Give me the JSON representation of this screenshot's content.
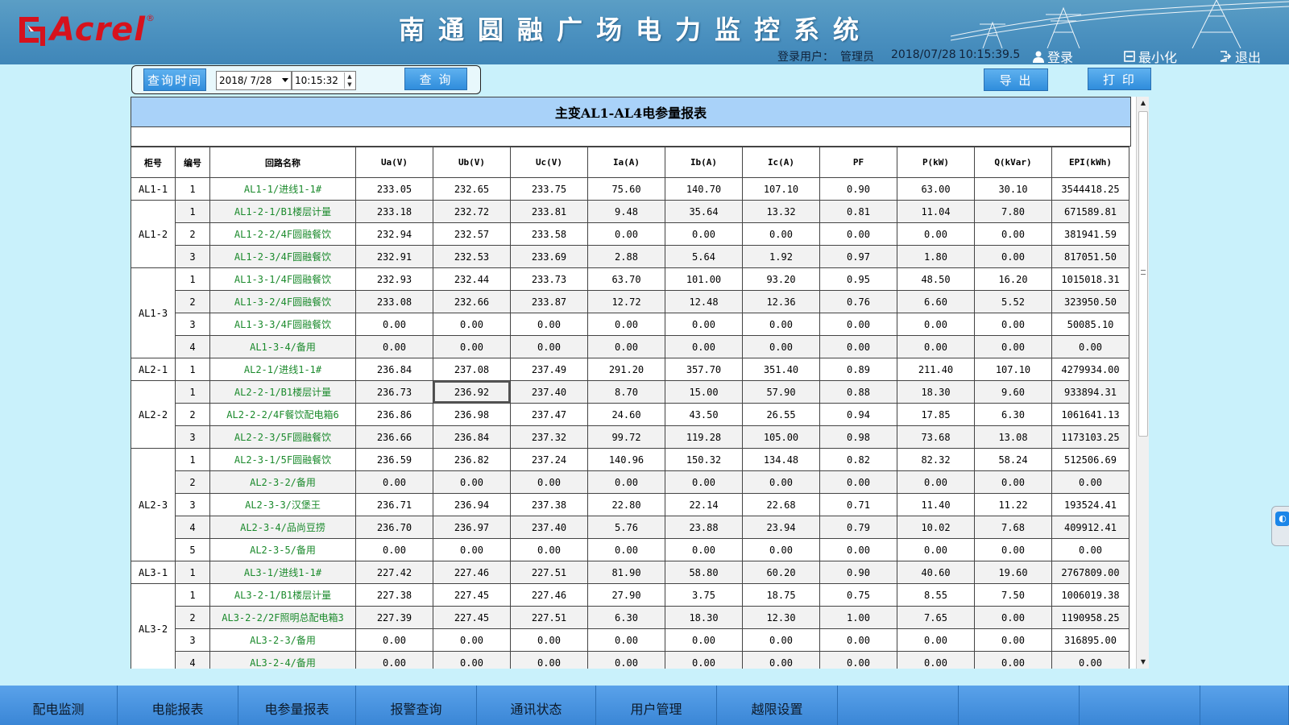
{
  "header": {
    "logo_text": "Acrel",
    "logo_reg": "®",
    "title": "南通圆融广场电力监控系统",
    "user_label": "登录用户：",
    "user_name": "管理员",
    "date": "2018/07/28",
    "time": "10:15:39.5",
    "login_label": "登录",
    "minimize_label": "最小化",
    "exit_label": "退出"
  },
  "query": {
    "time_button": "查询时间",
    "date_value": "2018/ 7/28",
    "time_value": "10:15:32",
    "search_button": "查 询"
  },
  "actions": {
    "export_label": "导 出",
    "print_label": "打 印"
  },
  "report": {
    "title": "主变AL1-AL4电参量报表",
    "columns": [
      "柜号",
      "编号",
      "回路名称",
      "Ua(V)",
      "Ub(V)",
      "Uc(V)",
      "Ia(A)",
      "Ib(A)",
      "Ic(A)",
      "PF",
      "P(kW)",
      "Q(kVar)",
      "EPI(kWh)"
    ],
    "groups": [
      {
        "cabinet": "AL1-1",
        "rows": [
          {
            "no": "1",
            "name": "AL1-1/进线1-1#",
            "ua": "233.05",
            "ub": "232.65",
            "uc": "233.75",
            "ia": "75.60",
            "ib": "140.70",
            "ic": "107.10",
            "pf": "0.90",
            "p": "63.00",
            "q": "30.10",
            "epi": "3544418.25"
          }
        ]
      },
      {
        "cabinet": "AL1-2",
        "rows": [
          {
            "no": "1",
            "name": "AL1-2-1/B1楼层计量",
            "ua": "233.18",
            "ub": "232.72",
            "uc": "233.81",
            "ia": "9.48",
            "ib": "35.64",
            "ic": "13.32",
            "pf": "0.81",
            "p": "11.04",
            "q": "7.80",
            "epi": "671589.81"
          },
          {
            "no": "2",
            "name": "AL1-2-2/4F圆融餐饮",
            "ua": "232.94",
            "ub": "232.57",
            "uc": "233.58",
            "ia": "0.00",
            "ib": "0.00",
            "ic": "0.00",
            "pf": "0.00",
            "p": "0.00",
            "q": "0.00",
            "epi": "381941.59"
          },
          {
            "no": "3",
            "name": "AL1-2-3/4F圆融餐饮",
            "ua": "232.91",
            "ub": "232.53",
            "uc": "233.69",
            "ia": "2.88",
            "ib": "5.64",
            "ic": "1.92",
            "pf": "0.97",
            "p": "1.80",
            "q": "0.00",
            "epi": "817051.50"
          }
        ]
      },
      {
        "cabinet": "AL1-3",
        "rows": [
          {
            "no": "1",
            "name": "AL1-3-1/4F圆融餐饮",
            "ua": "232.93",
            "ub": "232.44",
            "uc": "233.73",
            "ia": "63.70",
            "ib": "101.00",
            "ic": "93.20",
            "pf": "0.95",
            "p": "48.50",
            "q": "16.20",
            "epi": "1015018.31"
          },
          {
            "no": "2",
            "name": "AL1-3-2/4F圆融餐饮",
            "ua": "233.08",
            "ub": "232.66",
            "uc": "233.87",
            "ia": "12.72",
            "ib": "12.48",
            "ic": "12.36",
            "pf": "0.76",
            "p": "6.60",
            "q": "5.52",
            "epi": "323950.50"
          },
          {
            "no": "3",
            "name": "AL1-3-3/4F圆融餐饮",
            "ua": "0.00",
            "ub": "0.00",
            "uc": "0.00",
            "ia": "0.00",
            "ib": "0.00",
            "ic": "0.00",
            "pf": "0.00",
            "p": "0.00",
            "q": "0.00",
            "epi": "50085.10"
          },
          {
            "no": "4",
            "name": "AL1-3-4/备用",
            "ua": "0.00",
            "ub": "0.00",
            "uc": "0.00",
            "ia": "0.00",
            "ib": "0.00",
            "ic": "0.00",
            "pf": "0.00",
            "p": "0.00",
            "q": "0.00",
            "epi": "0.00"
          }
        ]
      },
      {
        "cabinet": "AL2-1",
        "rows": [
          {
            "no": "1",
            "name": "AL2-1/进线1-1#",
            "ua": "236.84",
            "ub": "237.08",
            "uc": "237.49",
            "ia": "291.20",
            "ib": "357.70",
            "ic": "351.40",
            "pf": "0.89",
            "p": "211.40",
            "q": "107.10",
            "epi": "4279934.00"
          }
        ]
      },
      {
        "cabinet": "AL2-2",
        "rows": [
          {
            "no": "1",
            "name": "AL2-2-1/B1楼层计量",
            "ua": "236.73",
            "ub": "236.92",
            "uc": "237.40",
            "ia": "8.70",
            "ib": "15.00",
            "ic": "57.90",
            "pf": "0.88",
            "p": "18.30",
            "q": "9.60",
            "epi": "933894.31"
          },
          {
            "no": "2",
            "name": "AL2-2-2/4F餐饮配电箱6",
            "ua": "236.86",
            "ub": "236.98",
            "uc": "237.47",
            "ia": "24.60",
            "ib": "43.50",
            "ic": "26.55",
            "pf": "0.94",
            "p": "17.85",
            "q": "6.30",
            "epi": "1061641.13"
          },
          {
            "no": "3",
            "name": "AL2-2-3/5F圆融餐饮",
            "ua": "236.66",
            "ub": "236.84",
            "uc": "237.32",
            "ia": "99.72",
            "ib": "119.28",
            "ic": "105.00",
            "pf": "0.98",
            "p": "73.68",
            "q": "13.08",
            "epi": "1173103.25"
          }
        ]
      },
      {
        "cabinet": "AL2-3",
        "rows": [
          {
            "no": "1",
            "name": "AL2-3-1/5F圆融餐饮",
            "ua": "236.59",
            "ub": "236.82",
            "uc": "237.24",
            "ia": "140.96",
            "ib": "150.32",
            "ic": "134.48",
            "pf": "0.82",
            "p": "82.32",
            "q": "58.24",
            "epi": "512506.69"
          },
          {
            "no": "2",
            "name": "AL2-3-2/备用",
            "ua": "0.00",
            "ub": "0.00",
            "uc": "0.00",
            "ia": "0.00",
            "ib": "0.00",
            "ic": "0.00",
            "pf": "0.00",
            "p": "0.00",
            "q": "0.00",
            "epi": "0.00"
          },
          {
            "no": "3",
            "name": "AL2-3-3/汉堡王",
            "ua": "236.71",
            "ub": "236.94",
            "uc": "237.38",
            "ia": "22.80",
            "ib": "22.14",
            "ic": "22.68",
            "pf": "0.71",
            "p": "11.40",
            "q": "11.22",
            "epi": "193524.41"
          },
          {
            "no": "4",
            "name": "AL2-3-4/品尚豆捞",
            "ua": "236.70",
            "ub": "236.97",
            "uc": "237.40",
            "ia": "5.76",
            "ib": "23.88",
            "ic": "23.94",
            "pf": "0.79",
            "p": "10.02",
            "q": "7.68",
            "epi": "409912.41"
          },
          {
            "no": "5",
            "name": "AL2-3-5/备用",
            "ua": "0.00",
            "ub": "0.00",
            "uc": "0.00",
            "ia": "0.00",
            "ib": "0.00",
            "ic": "0.00",
            "pf": "0.00",
            "p": "0.00",
            "q": "0.00",
            "epi": "0.00"
          }
        ]
      },
      {
        "cabinet": "AL3-1",
        "rows": [
          {
            "no": "1",
            "name": "AL3-1/进线1-1#",
            "ua": "227.42",
            "ub": "227.46",
            "uc": "227.51",
            "ia": "81.90",
            "ib": "58.80",
            "ic": "60.20",
            "pf": "0.90",
            "p": "40.60",
            "q": "19.60",
            "epi": "2767809.00"
          }
        ]
      },
      {
        "cabinet": "AL3-2",
        "rows": [
          {
            "no": "1",
            "name": "AL3-2-1/B1楼层计量",
            "ua": "227.38",
            "ub": "227.45",
            "uc": "227.46",
            "ia": "27.90",
            "ib": "3.75",
            "ic": "18.75",
            "pf": "0.75",
            "p": "8.55",
            "q": "7.50",
            "epi": "1006019.38"
          },
          {
            "no": "2",
            "name": "AL3-2-2/2F照明总配电箱3",
            "ua": "227.39",
            "ub": "227.45",
            "uc": "227.51",
            "ia": "6.30",
            "ib": "18.30",
            "ic": "12.30",
            "pf": "1.00",
            "p": "7.65",
            "q": "0.00",
            "epi": "1190958.25"
          },
          {
            "no": "3",
            "name": "AL3-2-3/备用",
            "ua": "0.00",
            "ub": "0.00",
            "uc": "0.00",
            "ia": "0.00",
            "ib": "0.00",
            "ic": "0.00",
            "pf": "0.00",
            "p": "0.00",
            "q": "0.00",
            "epi": "316895.00"
          },
          {
            "no": "4",
            "name": "AL3-2-4/备用",
            "ua": "0.00",
            "ub": "0.00",
            "uc": "0.00",
            "ia": "0.00",
            "ib": "0.00",
            "ic": "0.00",
            "pf": "0.00",
            "p": "0.00",
            "q": "0.00",
            "epi": "0.00"
          }
        ]
      }
    ]
  },
  "nav": {
    "items": [
      "配电监测",
      "电能报表",
      "电参量报表",
      "报警查询",
      "通讯状态",
      "用户管理",
      "越限设置",
      "",
      "",
      "",
      ""
    ]
  },
  "colors": {
    "header_blue": "#4a90bf",
    "page_bg": "#c9f1fb",
    "logo_red": "#d6121d",
    "report_title_bg": "#a9d2f9",
    "name_green": "#1b8a2c",
    "nav_blue": "#3a86d6"
  },
  "icons": {
    "login": "user-icon",
    "minimize": "minimize-icon",
    "exit": "exit-icon"
  }
}
